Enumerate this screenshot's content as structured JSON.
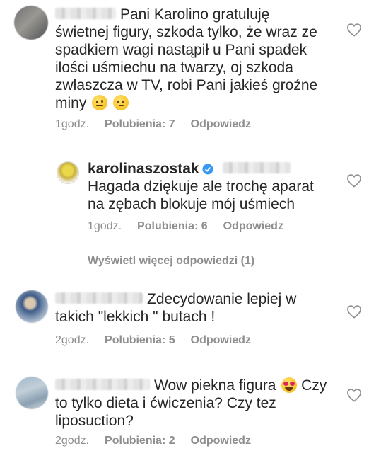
{
  "comments": [
    {
      "text": "Pani Karolino gratuluję świetnej figury, szkoda tylko, że wraz ze spadkiem wagi nastąpił u Pani spadek ilości uśmiechu na twarzy, oj szkoda zwłaszcza w TV, robi Pani jakieś groźne miny",
      "time": "1godz.",
      "likes": "Polubienia: 7",
      "reply": "Odpowiedz",
      "emojis": [
        "face-with-raised-eyebrow",
        "thinking-face"
      ]
    },
    {
      "username": "karolinaszostak",
      "verified": true,
      "text": "Hagada dziękuje ale trochę aparat na zębach blokuje mój uśmiech",
      "time": "1godz.",
      "likes": "Polubienia: 6",
      "reply": "Odpowiedz"
    },
    {
      "text": "Zdecydowanie lepiej w takich \"lekkich \" butach !",
      "time": "2godz.",
      "likes": "Polubienia: 5",
      "reply": "Odpowiedz"
    },
    {
      "text_before": "Wow piekna figura",
      "text_after": "Czy to tylko dieta i ćwiczenia? Czy tez liposuction?",
      "time": "2godz.",
      "likes": "Polubienia: 2",
      "reply": "Odpowiedz",
      "emojis": [
        "heart-eyes-face"
      ]
    }
  ],
  "view_more_replies": "Wyświetl więcej odpowiedzi (1)",
  "colors": {
    "text": "#262626",
    "meta": "#8e8e8e",
    "verified": "#3897f0"
  },
  "icons": [
    "heart-outline-icon",
    "verified-badge-icon"
  ]
}
